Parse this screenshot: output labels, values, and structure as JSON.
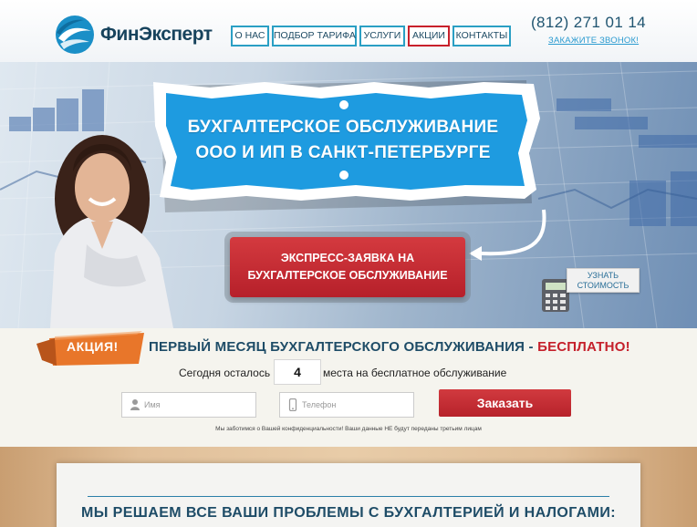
{
  "header": {
    "logo_text": "ФинЭксперт",
    "nav": [
      {
        "label": "О НАС"
      },
      {
        "label": "ПОДБОР ТАРИФА"
      },
      {
        "label": "УСЛУГИ"
      },
      {
        "label": "АКЦИИ",
        "active": true
      },
      {
        "label": "КОНТАКТЫ"
      }
    ],
    "phone": "(812) 271 01 14",
    "callback_label": "ЗАКАЖИТЕ ЗВОНОК!"
  },
  "hero": {
    "title_line1": "БУХГАЛТЕРСКОЕ ОБСЛУЖИВАНИЕ",
    "title_line2": "ООО И ИП В САНКТ-ПЕТЕРБУРГЕ",
    "express_line1": "ЭКСПРЕСС-ЗАЯВКА НА",
    "express_line2": "БУХГАЛТЕРСКОЕ ОБСЛУЖИВАНИЕ",
    "price_line1": "УЗНАТЬ",
    "price_line2": "СТОИМОСТЬ",
    "icons": [
      "woman-photo",
      "curved-arrow-icon",
      "calculator-icon"
    ]
  },
  "promo": {
    "badge": "АКЦИЯ!",
    "title_main": "ПЕРВЫЙ МЕСЯЦ БУХГАЛТЕРСКОГО ОБСЛУЖИВАНИЯ",
    "title_sep": " - ",
    "title_accent": "БЕСПЛАТНО!",
    "left_label": "Сегодня осталось",
    "spots_left": "4",
    "right_label": "места на бесплатное обслуживание",
    "name_placeholder": "Имя",
    "phone_placeholder": "Телефон",
    "order_label": "Заказать",
    "privacy": "Мы заботимся о Вашей конфиденциальности! Ваши данные НЕ будут переданы третьим лицам"
  },
  "problems": {
    "title": "МЫ РЕШАЕМ ВСЕ ВАШИ ПРОБЛЕМЫ С БУХГАЛТЕРИЕЙ И НАЛОГАМИ:"
  },
  "colors": {
    "brand_dark": "#1e4c67",
    "accent_blue": "#2a9fc4",
    "accent_red": "#c5202b",
    "banner_blue": "#1e9be0",
    "badge_orange": "#e8762a"
  }
}
